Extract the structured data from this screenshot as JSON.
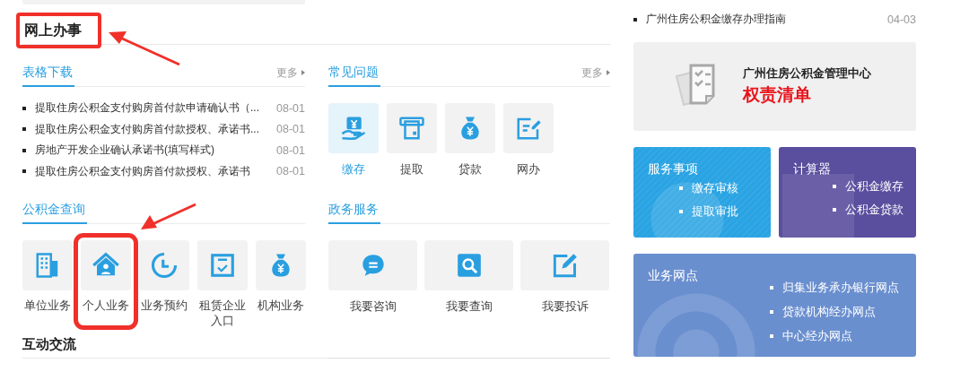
{
  "heading": {
    "text": "网上办事",
    "highlighted": true
  },
  "forms": {
    "title": "表格下载",
    "more": "更多",
    "items": [
      {
        "title": "提取住房公积金支付购房首付款申请确认书（...",
        "date": "08-01"
      },
      {
        "title": "提取住房公积金支付购房首付款授权、承诺书...",
        "date": "08-01"
      },
      {
        "title": "房地产开发企业确认承诺书(填写样式)",
        "date": "08-01"
      },
      {
        "title": "提取住房公积金支付购房首付款授权、承诺书",
        "date": "08-01"
      }
    ]
  },
  "faq": {
    "title": "常见问题",
    "more": "更多",
    "tiles": [
      {
        "label": "缴存",
        "selected": true
      },
      {
        "label": "提取",
        "selected": false
      },
      {
        "label": "贷款",
        "selected": false
      },
      {
        "label": "网办",
        "selected": false
      }
    ]
  },
  "query": {
    "title": "公积金查询",
    "tiles": [
      {
        "label": "单位业务",
        "highlighted": false
      },
      {
        "label": "个人业务",
        "highlighted": true
      },
      {
        "label": "业务预约",
        "highlighted": false
      },
      {
        "label": "租赁企业入口",
        "highlighted": false
      },
      {
        "label": "机构业务",
        "highlighted": false
      }
    ]
  },
  "gov": {
    "title": "政务服务",
    "tiles": [
      {
        "label": "我要咨询"
      },
      {
        "label": "我要查询"
      },
      {
        "label": "我要投诉"
      }
    ]
  },
  "interaction": {
    "title": "互动交流"
  },
  "guides": [
    {
      "title": "广州住房公积金缴存办理指南",
      "date": "04-03"
    }
  ],
  "banner": {
    "org": "广州住房公积金管理中心",
    "title": "权责清单"
  },
  "cards": [
    {
      "title": "服务事项",
      "color": "#29a3e3",
      "links": [
        "缴存审核",
        "提取审批"
      ]
    },
    {
      "title": "计算器",
      "color": "#5a4e9e",
      "links": [
        "公积金缴存",
        "公积金贷款"
      ]
    },
    {
      "title": "业务网点",
      "color": "#6a8fcf",
      "links": [
        "归集业务承办银行网点",
        "贷款机构经办网点",
        "中心经办网点"
      ]
    }
  ]
}
